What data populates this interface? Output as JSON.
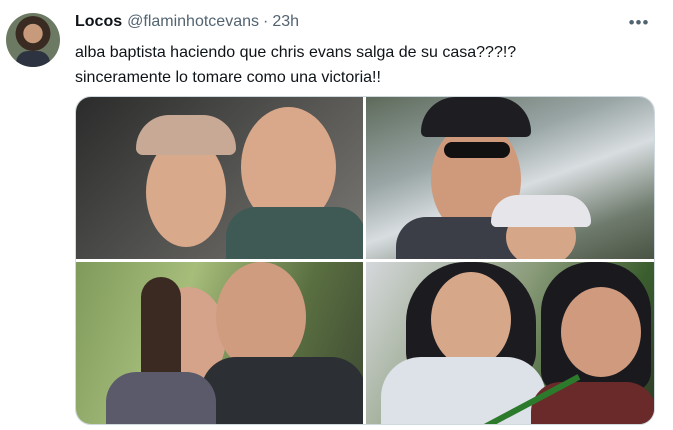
{
  "tweet": {
    "display_name": "Locos",
    "handle": "@flaminhotcevans",
    "separator": "·",
    "time": "23h",
    "more_glyph": "•••",
    "text_lines": [
      "alba baptista haciendo que chris evans salga de su casa???!?",
      "sinceramente lo tomare como una victoria!!"
    ],
    "media_count": 4
  },
  "colors": {
    "text_primary": "#0f1419",
    "text_secondary": "#536471",
    "border": "#cfd9de",
    "background": "#ffffff"
  }
}
